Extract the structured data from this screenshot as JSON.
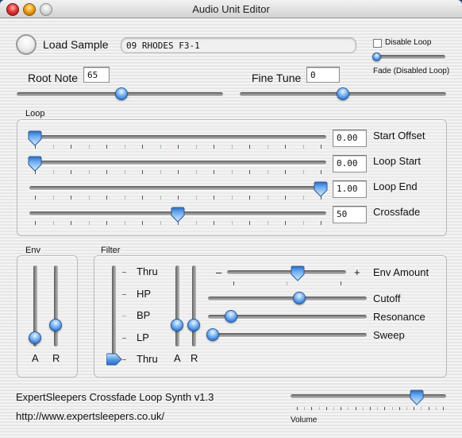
{
  "window": {
    "title": "Audio Unit Editor",
    "controls": [
      "close",
      "minimize",
      "zoom"
    ]
  },
  "sample": {
    "load_label": "Load Sample",
    "file_name": "09 RHODES F3-1",
    "disable_loop_label": "Disable Loop",
    "disable_loop_checked": false,
    "fade_label": "Fade (Disabled Loop)",
    "fade_value": 0.0
  },
  "tuning": {
    "root_note_label": "Root Note",
    "root_note_value": "65",
    "root_note_slider": 0.51,
    "fine_tune_label": "Fine Tune",
    "fine_tune_value": "0",
    "fine_tune_slider": 0.5
  },
  "loop": {
    "group_label": "Loop",
    "sliders": [
      {
        "label": "Start Offset",
        "value": "0.00",
        "position": 0.0
      },
      {
        "label": "Loop Start",
        "value": "0.00",
        "position": 0.0
      },
      {
        "label": "Loop End",
        "value": "1.00",
        "position": 1.0
      },
      {
        "label": "Crossfade",
        "value": "50",
        "position": 0.5
      }
    ]
  },
  "env": {
    "group_label": "Env",
    "sliders": [
      {
        "label": "A",
        "position": 0.08
      },
      {
        "label": "R",
        "position": 0.25
      }
    ]
  },
  "filter": {
    "group_label": "Filter",
    "type_options": [
      "Thru",
      "HP",
      "BP",
      "LP",
      "Thru"
    ],
    "type_selected_index": 4,
    "env_sliders": [
      {
        "label": "A",
        "position": 0.25
      },
      {
        "label": "R",
        "position": 0.25
      }
    ],
    "env_amount": {
      "label": "Env Amount",
      "minus": "–",
      "plus": "+",
      "position": 0.6
    },
    "cutoff": {
      "label": "Cutoff",
      "position": 0.58
    },
    "resonance": {
      "label": "Resonance",
      "position": 0.12
    },
    "sweep": {
      "label": "Sweep",
      "position": 0.0
    }
  },
  "footer": {
    "product": "ExpertSleepers Crossfade Loop Synth v1.3",
    "url": "http://www.expertsleepers.co.uk/",
    "volume_label": "Volume",
    "volume_position": 0.82
  }
}
